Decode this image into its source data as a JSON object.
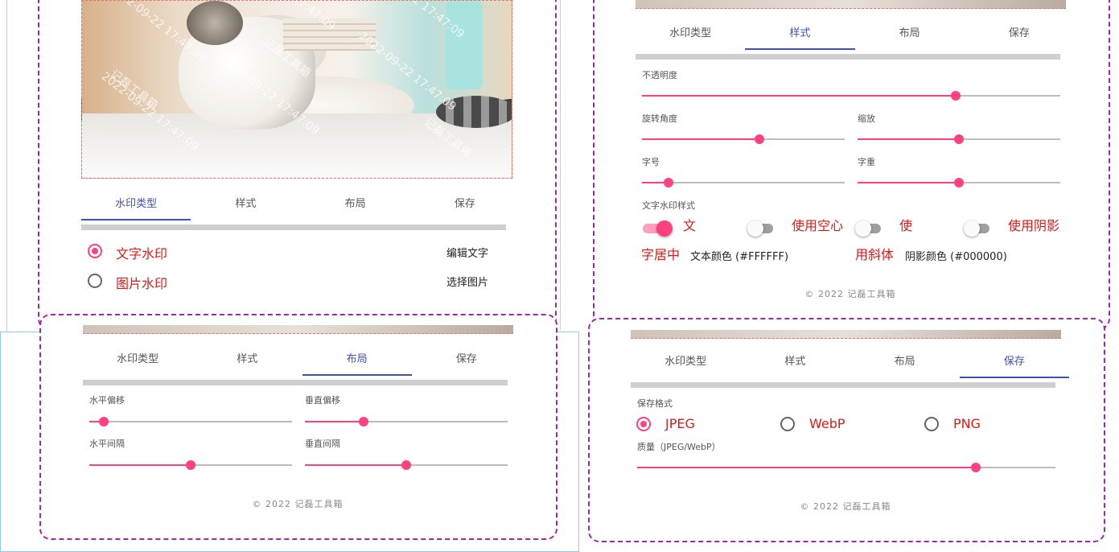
{
  "tabs": [
    "水印类型",
    "样式",
    "布局",
    "保存"
  ],
  "footer": "© 2022 记磊工具箱",
  "watermark_text": "记磊工具箱",
  "watermark_date": "2022-09-22 17:47:09",
  "panel_type": {
    "active_tab": 0,
    "options": [
      {
        "label": "文字水印",
        "selected": true,
        "action": "编辑文字"
      },
      {
        "label": "图片水印",
        "selected": false,
        "action": "选择图片"
      }
    ]
  },
  "panel_style": {
    "active_tab": 1,
    "opacity": {
      "label": "不透明度",
      "value": 0.75
    },
    "rotation": {
      "label": "旋转角度",
      "value": 0.58
    },
    "scale": {
      "label": "缩放",
      "value": 0.5
    },
    "font_size": {
      "label": "字号",
      "value": 0.13
    },
    "font_weight": {
      "label": "字重",
      "value": 0.5
    },
    "text_style_label": "文字水印样式",
    "switches": [
      {
        "label": "文字居中",
        "on": true
      },
      {
        "label": "使用空心",
        "on": false
      },
      {
        "label": "使用斜体",
        "on": false
      },
      {
        "label": "使用阴影",
        "on": false
      }
    ],
    "text_color": "文本颜色 (#FFFFFF)",
    "shadow_color": "阴影颜色 (#000000)"
  },
  "panel_layout": {
    "active_tab": 2,
    "h_offset": {
      "label": "水平偏移",
      "value": 0.07
    },
    "v_offset": {
      "label": "垂直偏移",
      "value": 0.29
    },
    "h_gap": {
      "label": "水平间隔",
      "value": 0.5
    },
    "v_gap": {
      "label": "垂直间隔",
      "value": 0.5
    }
  },
  "panel_save": {
    "active_tab": 3,
    "format_label": "保存格式",
    "formats": [
      {
        "label": "JPEG",
        "selected": true
      },
      {
        "label": "WebP",
        "selected": false
      },
      {
        "label": "PNG",
        "selected": false
      }
    ],
    "quality": {
      "label": "质量（JPEG/WebP）",
      "value": 0.81
    }
  },
  "colors": {
    "accent": "#ff4081",
    "primary": "#3f51b5",
    "border": "#9c27b0",
    "label_red": "#e01818"
  }
}
